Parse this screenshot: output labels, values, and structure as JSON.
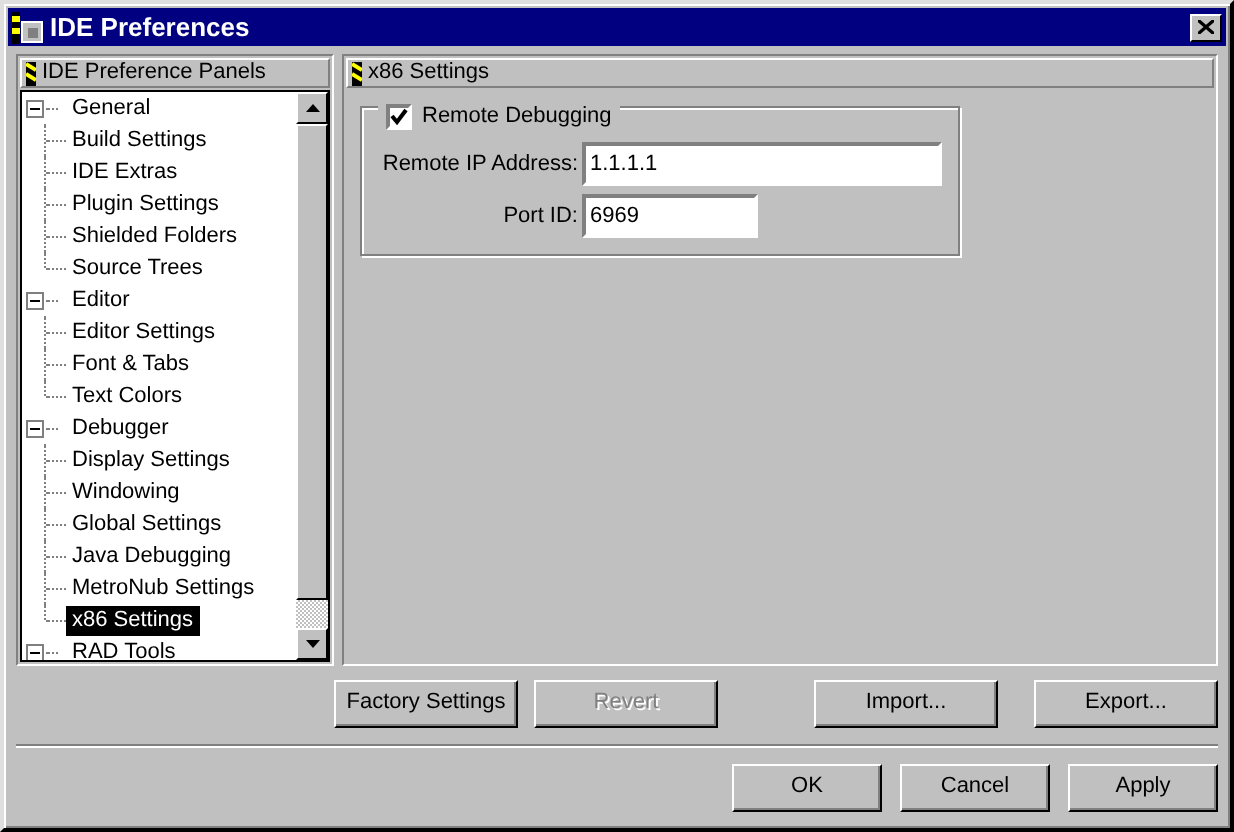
{
  "window": {
    "title": "IDE Preferences"
  },
  "tree": {
    "title": "IDE Preference Panels",
    "items": [
      {
        "label": "General",
        "expanded": true,
        "selected": false,
        "children": [
          {
            "label": "Build Settings",
            "selected": false
          },
          {
            "label": "IDE Extras",
            "selected": false
          },
          {
            "label": "Plugin Settings",
            "selected": false
          },
          {
            "label": "Shielded Folders",
            "selected": false
          },
          {
            "label": "Source Trees",
            "selected": false
          }
        ]
      },
      {
        "label": "Editor",
        "expanded": true,
        "selected": false,
        "children": [
          {
            "label": "Editor Settings",
            "selected": false
          },
          {
            "label": "Font & Tabs",
            "selected": false
          },
          {
            "label": "Text Colors",
            "selected": false
          }
        ]
      },
      {
        "label": "Debugger",
        "expanded": true,
        "selected": false,
        "children": [
          {
            "label": "Display Settings",
            "selected": false
          },
          {
            "label": "Windowing",
            "selected": false
          },
          {
            "label": "Global Settings",
            "selected": false
          },
          {
            "label": "Java Debugging",
            "selected": false
          },
          {
            "label": "MetroNub Settings",
            "selected": false
          },
          {
            "label": "x86 Settings",
            "selected": true
          }
        ]
      },
      {
        "label": "RAD Tools",
        "expanded": true,
        "selected": false
      }
    ]
  },
  "panel": {
    "title": "x86 Settings",
    "remote_debugging": {
      "label": "Remote Debugging",
      "checked": true
    },
    "fields": [
      {
        "label": "Remote IP Address:",
        "value": "1.1.1.1"
      },
      {
        "label": "Port ID:",
        "value": "6969"
      }
    ]
  },
  "action_buttons": [
    {
      "label": "Factory Settings",
      "disabled": false
    },
    {
      "label": "Revert",
      "disabled": true
    },
    {
      "label": "Import...",
      "disabled": false
    },
    {
      "label": "Export...",
      "disabled": false
    }
  ],
  "dialog_buttons": [
    {
      "label": "OK",
      "disabled": false
    },
    {
      "label": "Cancel",
      "disabled": false
    },
    {
      "label": "Apply",
      "disabled": false
    }
  ]
}
